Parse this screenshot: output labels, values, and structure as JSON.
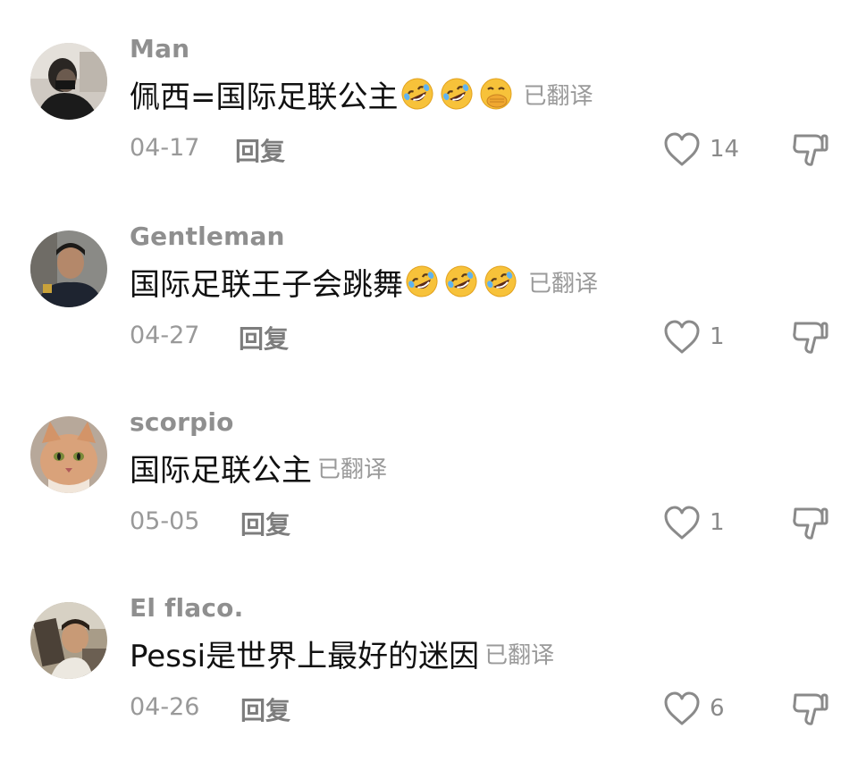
{
  "comments": [
    {
      "username": "Man",
      "text": "佩西=国际足联公主",
      "emojis": [
        "rofl-emoji",
        "rofl-emoji",
        "hand-over-mouth-emoji"
      ],
      "translated_label": "已翻译",
      "date": "04-17",
      "reply_label": "回复",
      "likes": "14"
    },
    {
      "username": "Gentleman",
      "text": "国际足联王子会跳舞",
      "emojis": [
        "rofl-emoji",
        "rofl-emoji",
        "rofl-emoji"
      ],
      "translated_label": "已翻译",
      "date": "04-27",
      "reply_label": "回复",
      "likes": "1"
    },
    {
      "username": "scorpio",
      "text": "国际足联公主",
      "emojis": [],
      "translated_label": "已翻译",
      "date": "05-05",
      "reply_label": "回复",
      "likes": "1"
    },
    {
      "username": "El flaco.",
      "text": "Pessi是世界上最好的迷因",
      "emojis": [],
      "translated_label": "已翻译",
      "date": "04-26",
      "reply_label": "回复",
      "likes": "6"
    }
  ],
  "colors": {
    "username": "#8f8f8f",
    "text": "#111111",
    "meta": "#999999",
    "emoji_face": "#f7c23a"
  }
}
